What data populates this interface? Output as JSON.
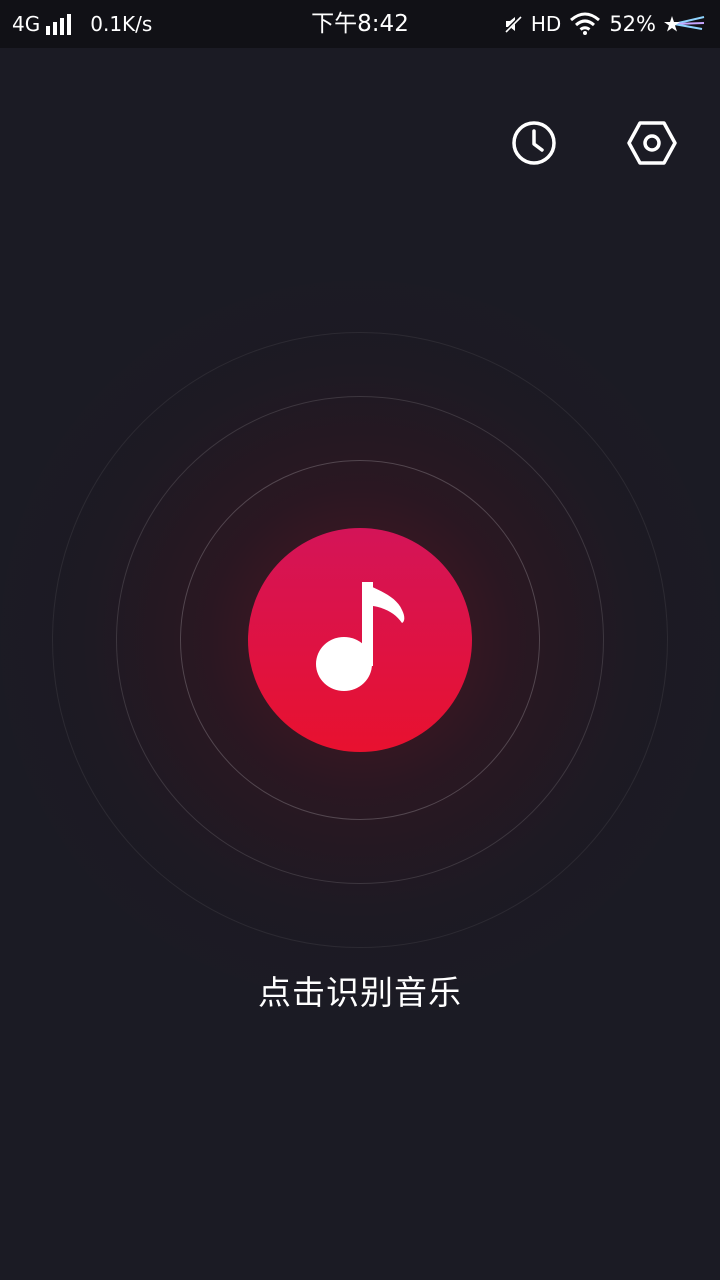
{
  "status_bar": {
    "network": "4G",
    "speed": "0.1K/s",
    "time": "下午8:42",
    "hd": "HD",
    "battery": "52%",
    "icons": [
      "signal-icon",
      "mute-icon",
      "wifi-icon",
      "shooting-star-icon"
    ]
  },
  "toolbar": {
    "history_icon": "clock-icon",
    "settings_icon": "hexagon-settings-icon"
  },
  "main": {
    "button_icon": "music-note-icon",
    "hint": "点击识别音乐"
  },
  "colors": {
    "background": "#1b1b24",
    "status_bar": "#111116",
    "accent_top": "#d41458",
    "accent_bottom": "#e8112f",
    "text": "#ffffff"
  }
}
